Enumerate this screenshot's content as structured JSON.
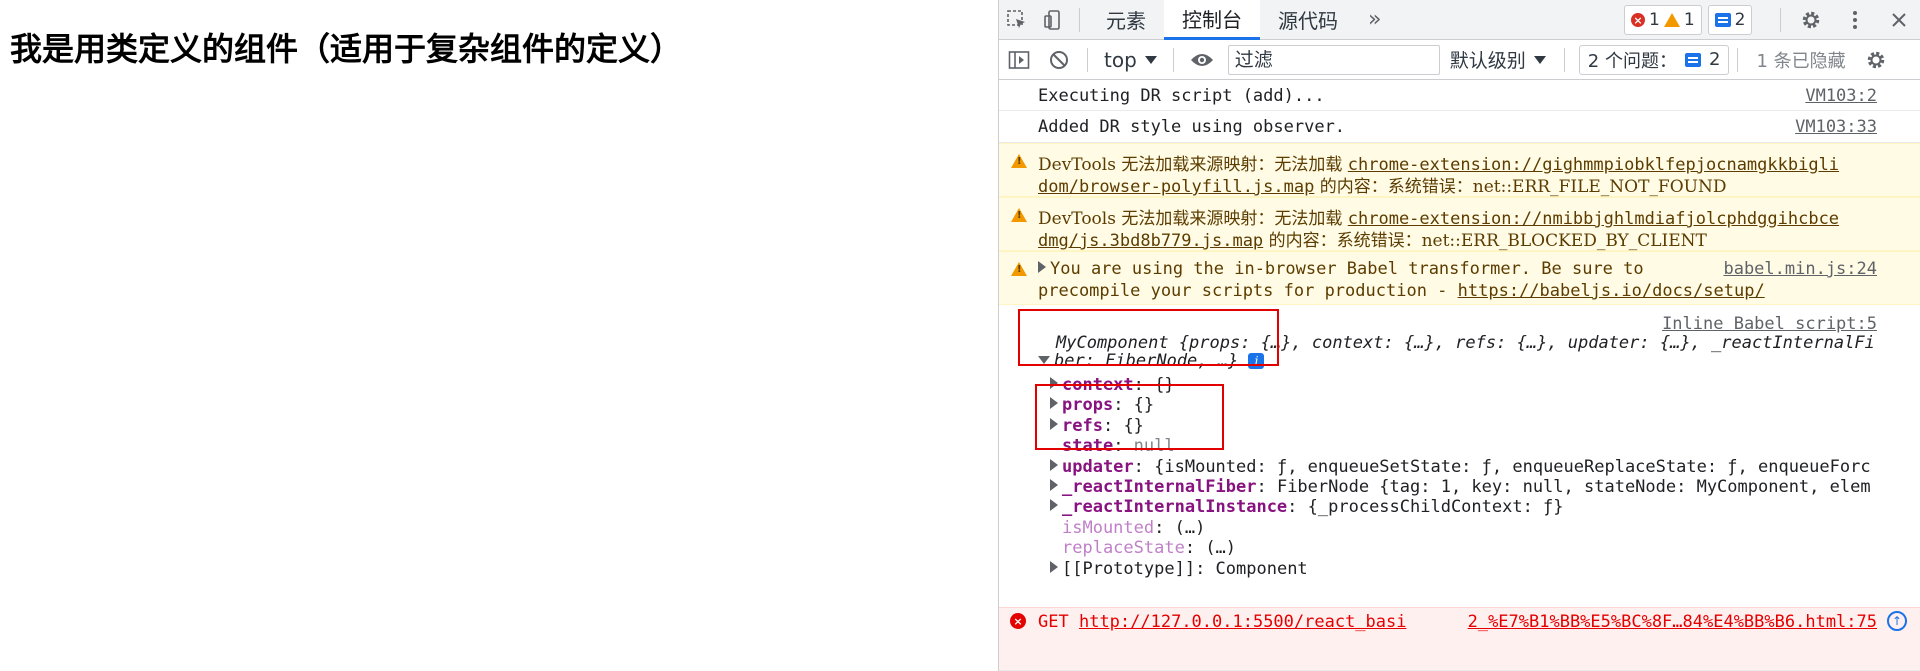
{
  "page": {
    "heading": "我是用类定义的组件（适用于复杂组件的定义）"
  },
  "devtools": {
    "tabs": [
      "元素",
      "控制台",
      "源代码"
    ],
    "active_tab": "控制台",
    "counters": {
      "errors": "1",
      "warnings": "1",
      "messages": "2"
    },
    "filter": {
      "context": "top",
      "placeholder": "过滤",
      "levels": "默认级别",
      "issues_label": "2 个问题：",
      "issues_count": "2",
      "hidden": "1 条已隐藏"
    },
    "icons": {
      "inspect": "inspect-element-icon",
      "device": "device-toolbar-icon",
      "settings": "gear-icon",
      "menu": "kebab-menu-icon",
      "close": "close-icon"
    }
  },
  "console": {
    "msg1": {
      "text": "Executing DR script (add)...",
      "source": "VM103:2"
    },
    "msg2": {
      "text": "Added DR style using observer.",
      "source": "VM103:33"
    },
    "warn1": {
      "prefix": "DevTools 无法加载来源映射：无法加载 ",
      "link1": "chrome-extension://gighmmpiobklfepjocnamgkkbigli",
      "link2": "dom/browser-polyfill.js.map",
      "suffix": " 的内容：系统错误：net::ERR_FILE_NOT_FOUND"
    },
    "warn2": {
      "prefix": "DevTools 无法加载来源映射：无法加载 ",
      "link1": "chrome-extension://nmibbjghlmdiafjolcphdggihcbce",
      "link2": "dmg/js.3bd8b779.js.map",
      "suffix": " 的内容：系统错误：net::ERR_BLOCKED_BY_CLIENT"
    },
    "warn3": {
      "line1": "You are using the in-browser Babel transformer. Be sure to",
      "line2": "precompile your scripts for production - ",
      "link": "https://babeljs.io/docs/setup/",
      "source": "babel.min.js:24"
    },
    "object": {
      "source": "Inline Babel script:5",
      "line1": "MyComponent {props: {…}, context: {…}, refs: {…}, updater: {…}, _reactInternalFi",
      "line2": "ber: FiberNode, …}",
      "info": "i",
      "props": [
        {
          "key": "context",
          "value": "{}",
          "expandable": true,
          "bold": true
        },
        {
          "key": "props",
          "value": "{}",
          "expandable": true,
          "bold": true
        },
        {
          "key": "refs",
          "value": "{}",
          "expandable": true,
          "bold": true
        },
        {
          "key": "state",
          "value": "null",
          "expandable": false,
          "bold": true
        },
        {
          "key": "updater",
          "value": "{isMounted: ƒ, enqueueSetState: ƒ, enqueueReplaceState: ƒ, enqueueForc",
          "expandable": true,
          "bold": true
        },
        {
          "key": "_reactInternalFiber",
          "value": "FiberNode {tag: 1, key: null, stateNode: MyComponent, elem",
          "expandable": true,
          "bold": true
        },
        {
          "key": "_reactInternalInstance",
          "value": "{_processChildContext: ƒ}",
          "expandable": true,
          "bold": true
        },
        {
          "key": "isMounted",
          "value": "(…)",
          "expandable": false,
          "bold": false
        },
        {
          "key": "replaceState",
          "value": "(…)",
          "expandable": false,
          "bold": false
        },
        {
          "key": "[[Prototype]]",
          "value": "Component",
          "expandable": true,
          "bold": false
        }
      ]
    },
    "error": {
      "method": "GET",
      "url": "http://127.0.0.1:5500/react_basi",
      "source": "2_%E7%B1%BB%E5%BC%8F…84%E4%BB%B6.html:75"
    }
  }
}
